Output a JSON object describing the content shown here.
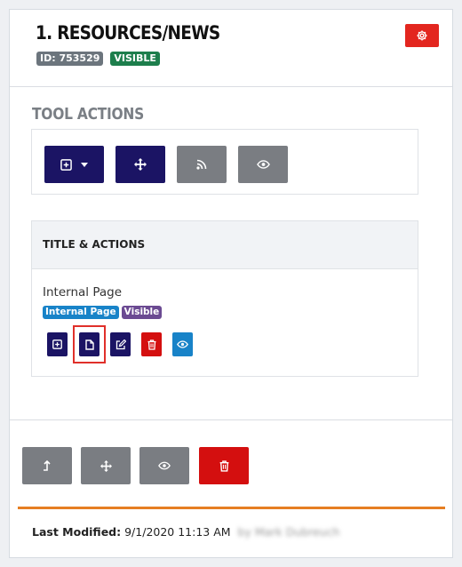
{
  "header": {
    "title": "1. RESOURCES/NEWS",
    "id_badge": "ID: 753529",
    "visibility_badge": "VISIBLE",
    "settings_icon": "gear-icon"
  },
  "tool_actions": {
    "title": "TOOL ACTIONS",
    "buttons": [
      {
        "name": "add-dropdown",
        "icon": "plus-square-icon",
        "has_caret": true,
        "color": "#1b1464"
      },
      {
        "name": "move",
        "icon": "move-arrows-icon",
        "color": "#1b1464"
      },
      {
        "name": "rss",
        "icon": "rss-icon",
        "color": "#7a7d82"
      },
      {
        "name": "view",
        "icon": "eye-icon",
        "color": "#7a7d82"
      }
    ]
  },
  "panel": {
    "header": "TITLE & ACTIONS",
    "item": {
      "title": "Internal Page",
      "badges": [
        "Internal Page",
        "Visible"
      ],
      "actions": [
        {
          "name": "add",
          "icon": "plus-square-icon",
          "color": "#1b1464"
        },
        {
          "name": "page",
          "icon": "file-icon",
          "color": "#1b1464",
          "highlighted": true
        },
        {
          "name": "edit",
          "icon": "edit-icon",
          "color": "#1b1464"
        },
        {
          "name": "delete",
          "icon": "trash-icon",
          "color": "#d40f0f"
        },
        {
          "name": "view",
          "icon": "eye-icon",
          "color": "#1883c8"
        }
      ]
    }
  },
  "bottom_actions": [
    {
      "name": "level-up",
      "icon": "level-up-icon",
      "color": "#7a7d82"
    },
    {
      "name": "move",
      "icon": "move-arrows-icon",
      "color": "#7a7d82"
    },
    {
      "name": "view",
      "icon": "eye-icon",
      "color": "#7a7d82"
    },
    {
      "name": "delete",
      "icon": "trash-icon",
      "color": "#d40f0f"
    }
  ],
  "footer": {
    "label": "Last Modified:",
    "value": "9/1/2020 11:13 AM",
    "user_redacted": "by Mark Dubreuch"
  },
  "colors": {
    "accent_red": "#e3261f",
    "navy": "#1b1464",
    "gray": "#7a7d82",
    "orange_rule": "#e67e22"
  }
}
